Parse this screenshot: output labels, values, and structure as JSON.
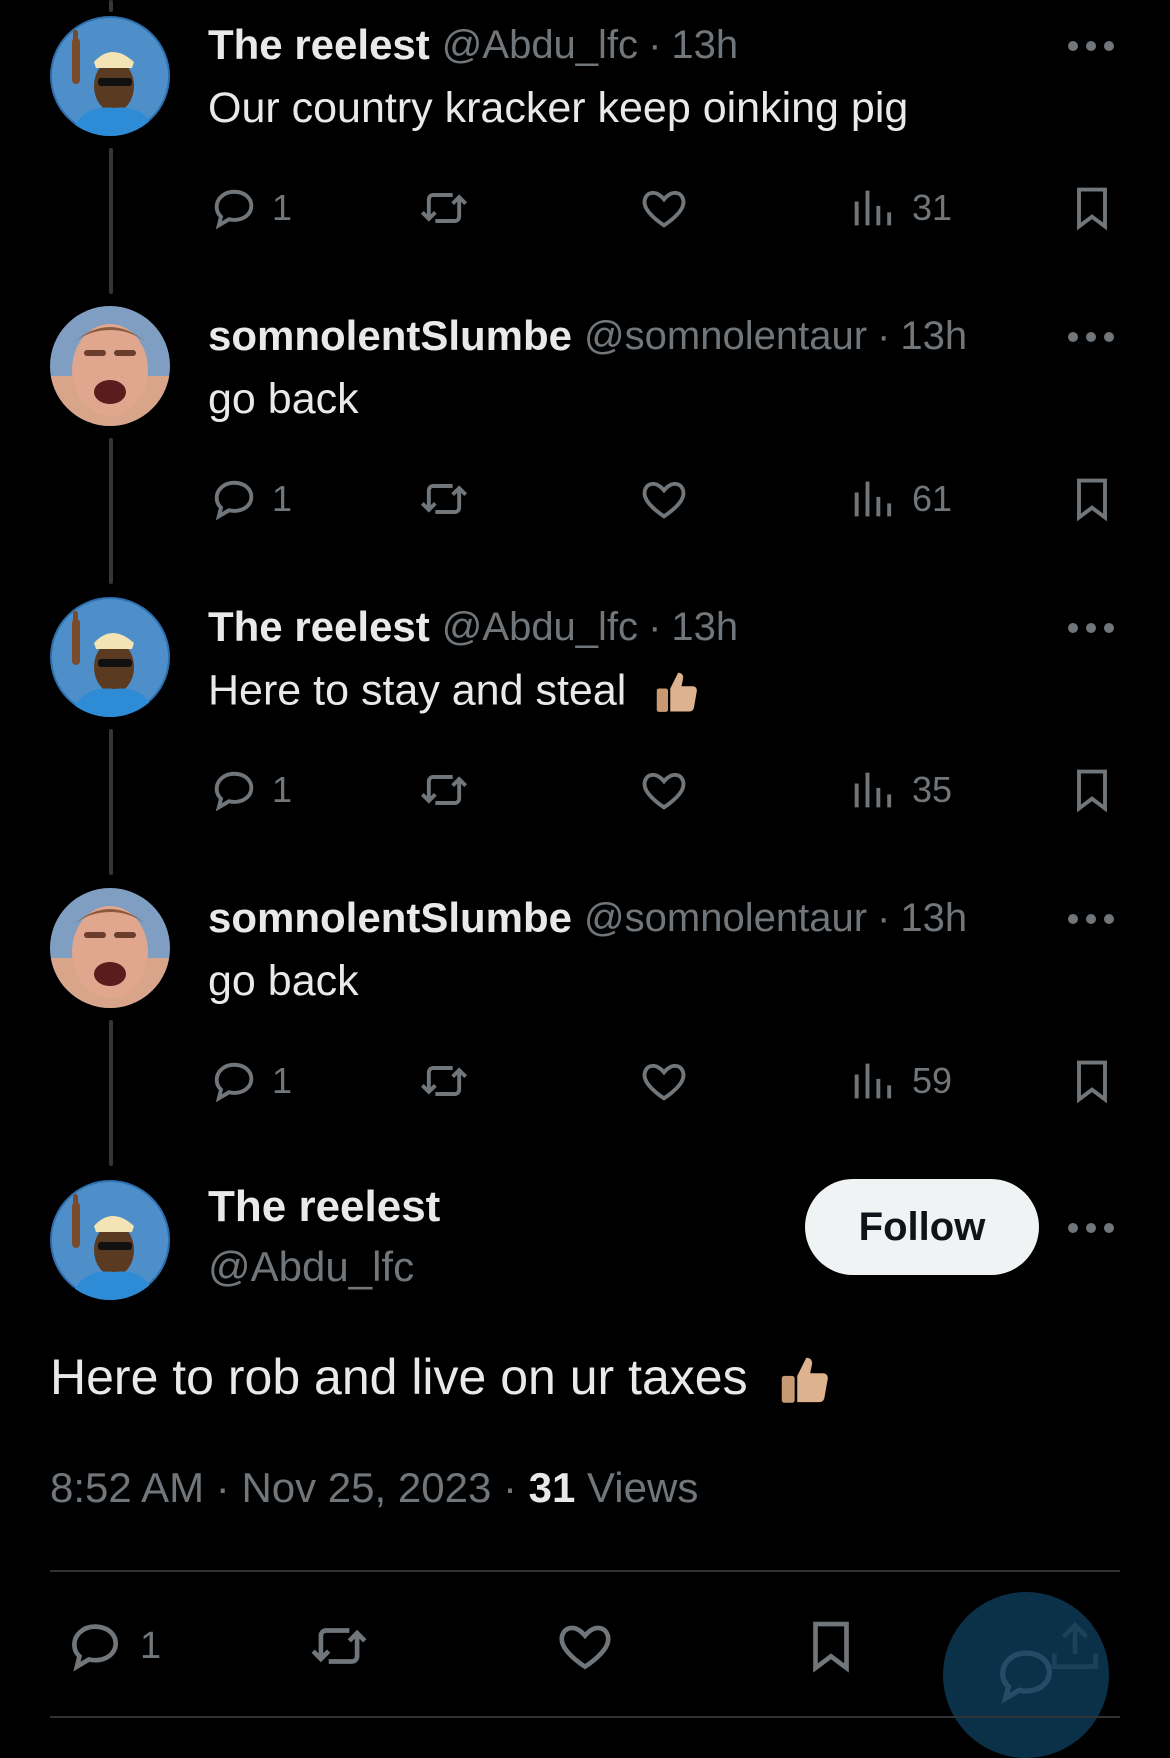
{
  "replies": [
    {
      "name": "The reelest",
      "handle": "@Abdu_lfc",
      "sep": "·",
      "time": "13h",
      "text": "Our country kracker keep oinking pig",
      "replies": "1",
      "views": "31",
      "emoji": false,
      "avatar": "osimhen"
    },
    {
      "name": "somnolentSlumbe",
      "handle": "@somnolentaur",
      "sep": "·",
      "time": "13h",
      "text": "go back",
      "replies": "1",
      "views": "61",
      "emoji": false,
      "avatar": "shouting"
    },
    {
      "name": "The reelest",
      "handle": "@Abdu_lfc",
      "sep": "·",
      "time": "13h",
      "text": "Here to stay and steal",
      "replies": "1",
      "views": "35",
      "emoji": true,
      "avatar": "osimhen"
    },
    {
      "name": "somnolentSlumbe",
      "handle": "@somnolentaur",
      "sep": "·",
      "time": "13h",
      "text": "go back",
      "replies": "1",
      "views": "59",
      "emoji": false,
      "avatar": "shouting"
    }
  ],
  "main_tweet": {
    "name": "The reelest",
    "handle": "@Abdu_lfc",
    "follow_label": "Follow",
    "text": "Here to rob and live on ur taxes",
    "time": "8:52 AM",
    "sep1": "·",
    "date": "Nov 25, 2023",
    "sep2": "·",
    "views_count": "31",
    "views_label": "Views",
    "reply_count": "1"
  },
  "icons": {
    "reply": "reply-icon",
    "retweet": "retweet-icon",
    "like": "like-icon",
    "views": "views-icon",
    "bookmark": "bookmark-icon",
    "share": "share-icon",
    "more": "more-icon",
    "thumbs_up": "thumbs-up-emoji",
    "compose": "compose-fab-icon"
  },
  "colors": {
    "background": "#000000",
    "text": "#e7e9ea",
    "muted": "#71767b",
    "follow_bg": "#eff3f4",
    "fab": "#0d3a56"
  }
}
